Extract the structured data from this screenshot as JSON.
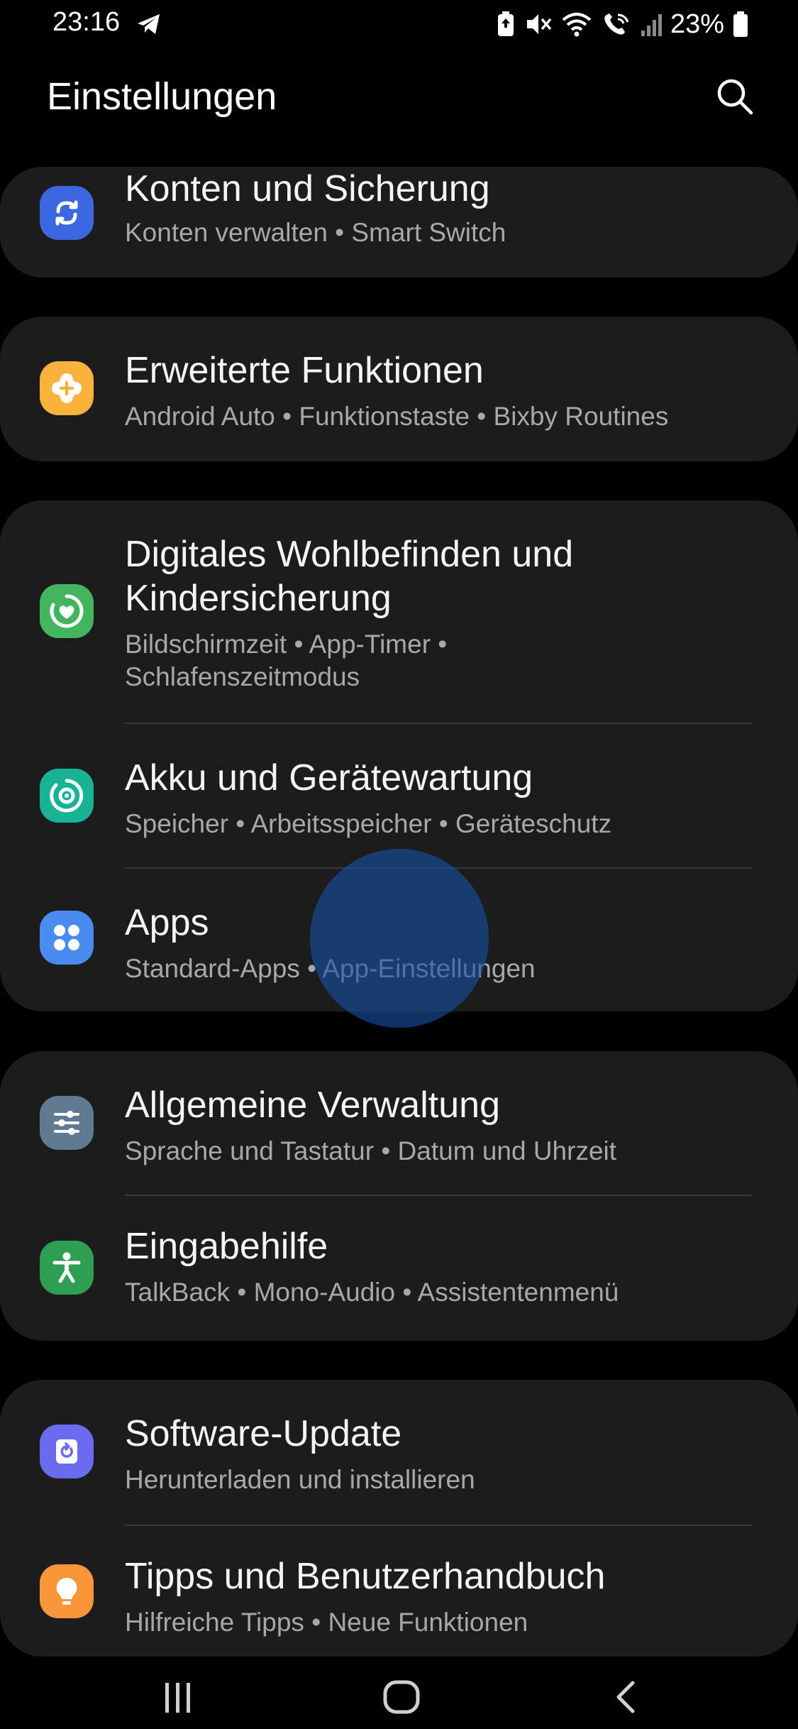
{
  "status_bar": {
    "time": "23:16",
    "battery_percent": "23%"
  },
  "header": {
    "title": "Einstellungen"
  },
  "colors": {
    "card_background": "#1c1c1c",
    "accounts_icon": "#3c67e0",
    "advanced_icon": "#f9b23c",
    "wellbeing_icon": "#43b55f",
    "battery_icon": "#17b394",
    "apps_icon": "#4a8bf0",
    "general_icon": "#607b91",
    "accessibility_icon": "#2e9e52",
    "software_icon": "#6b6bf0",
    "tips_icon": "#f9963a"
  },
  "settings": {
    "accounts": {
      "icon": "sync-icon",
      "title": "Konten und Sicherung",
      "subtitle": "Konten verwalten  •  Smart Switch"
    },
    "advanced": {
      "icon": "puzzle-plus-icon",
      "title": "Erweiterte Funktionen",
      "subtitle": "Android Auto  •  Funktionstaste  •  Bixby Routines"
    },
    "wellbeing": {
      "icon": "heart-ring-icon",
      "title": "Digitales Wohlbefinden und Kindersicherung",
      "subtitle": "Bildschirmzeit  •  App-Timer  •  Schlafenszeitmodus"
    },
    "battery": {
      "icon": "device-care-icon",
      "title": "Akku und Gerätewartung",
      "subtitle": "Speicher  •  Arbeitsspeicher  •  Geräteschutz"
    },
    "apps": {
      "icon": "apps-grid-icon",
      "title": "Apps",
      "subtitle": "Standard-Apps  •  App-Einstellungen"
    },
    "general": {
      "icon": "sliders-icon",
      "title": "Allgemeine Verwaltung",
      "subtitle": "Sprache und Tastatur  •  Datum und Uhrzeit"
    },
    "accessibility": {
      "icon": "accessibility-person-icon",
      "title": "Eingabehilfe",
      "subtitle": "TalkBack  •  Mono-Audio  •  Assistentenmenü"
    },
    "software_update": {
      "icon": "update-icon",
      "title": "Software-Update",
      "subtitle": "Herunterladen und installieren"
    },
    "tips": {
      "icon": "lightbulb-icon",
      "title": "Tipps und Benutzerhandbuch",
      "subtitle": "Hilfreiche Tipps  •  Neue Funktionen"
    }
  },
  "nav": {
    "recents": "recents-icon",
    "home": "home-icon",
    "back": "back-icon"
  }
}
